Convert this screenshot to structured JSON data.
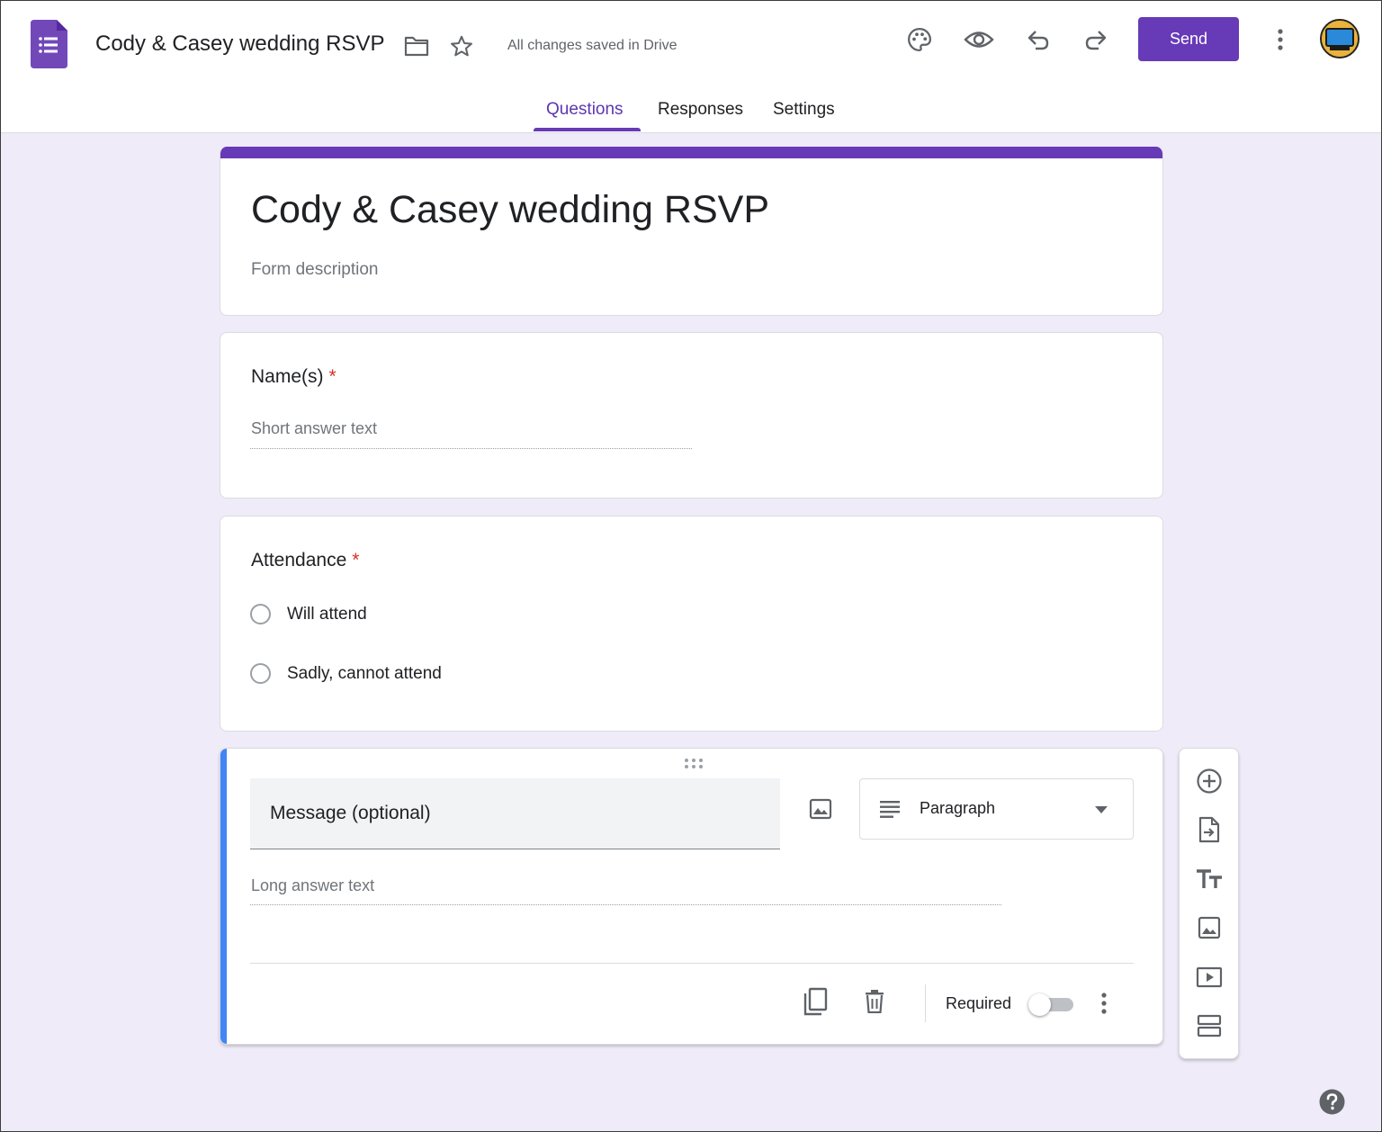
{
  "header": {
    "doc_title": "Cody & Casey wedding RSVP",
    "save_status": "All changes saved in Drive",
    "send_label": "Send",
    "icons": [
      "forms-logo-icon",
      "folder-icon",
      "star-icon",
      "palette-icon",
      "preview-eye-icon",
      "undo-icon",
      "redo-icon",
      "more-vert-icon",
      "avatar"
    ]
  },
  "tabs": [
    {
      "label": "Questions",
      "active": true
    },
    {
      "label": "Responses",
      "active": false
    },
    {
      "label": "Settings",
      "active": false
    }
  ],
  "form": {
    "title": "Cody & Casey wedding RSVP",
    "description_placeholder": "Form description"
  },
  "questions": [
    {
      "title": "Name(s)",
      "required_mark": "*",
      "answer_placeholder": "Short answer text"
    },
    {
      "title": "Attendance",
      "required_mark": "*",
      "options": [
        "Will attend",
        "Sadly, cannot attend"
      ]
    },
    {
      "title": "Message (optional)",
      "type_label": "Paragraph",
      "answer_placeholder": "Long answer text",
      "required_label": "Required",
      "required_on": false
    }
  ],
  "side_toolbar": {
    "icons": [
      "add-question-icon",
      "import-questions-icon",
      "add-title-icon",
      "add-image-icon",
      "add-video-icon",
      "add-section-icon"
    ]
  },
  "colors": {
    "accent": "#673ab7",
    "background": "#f0ebf8",
    "active_question_bar": "#4285f4",
    "required_star": "#d93025"
  }
}
